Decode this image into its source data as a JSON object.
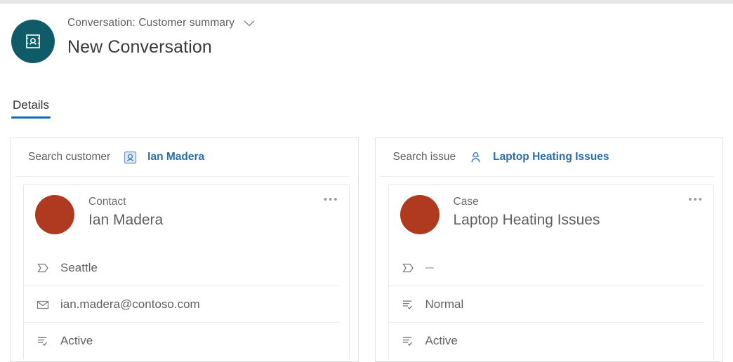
{
  "colors": {
    "header_avatar_bg": "#0f5b68",
    "entity_avatar_bg": "#b03a20",
    "tab_accent": "#0f6cbd",
    "link_blue": "#2a6ca8",
    "entity_icon_blue": "#7aa7cf"
  },
  "header": {
    "avatar_icon": "conversation-icon",
    "subtitle": "Conversation: Customer summary",
    "dropdown_icon": "chevron-down-icon",
    "title": "New Conversation"
  },
  "tabs": [
    {
      "label": "Details",
      "active": true
    }
  ],
  "cards": [
    {
      "search": {
        "label": "Search customer",
        "entity_icon": "contact-card-icon",
        "value": "Ian Madera"
      },
      "entity": {
        "type": "Contact",
        "name": "Ian Madera",
        "overflow_label": "•••",
        "rows": [
          {
            "icon": "tag-icon",
            "value": "Seattle",
            "muted": false
          },
          {
            "icon": "envelope-icon",
            "value": "ian.madera@contoso.com",
            "muted": false
          },
          {
            "icon": "status-list-icon",
            "value": "Active",
            "muted": false
          }
        ]
      }
    },
    {
      "search": {
        "label": "Search issue",
        "entity_icon": "case-person-icon",
        "value": "Laptop Heating Issues"
      },
      "entity": {
        "type": "Case",
        "name": "Laptop Heating Issues",
        "overflow_label": "•••",
        "rows": [
          {
            "icon": "tag-icon",
            "value": "---",
            "muted": true
          },
          {
            "icon": "status-list-icon",
            "value": "Normal",
            "muted": false
          },
          {
            "icon": "status-list-icon",
            "value": "Active",
            "muted": false
          }
        ]
      }
    }
  ]
}
